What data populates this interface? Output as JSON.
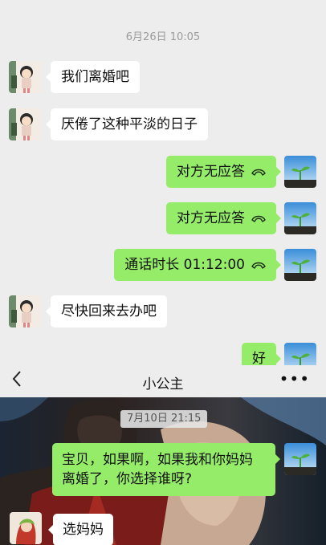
{
  "top_chat": {
    "timestamp": "6月26日 10:05",
    "messages": [
      {
        "side": "in",
        "text": "我们离婚吧"
      },
      {
        "side": "in",
        "text": "厌倦了这种平淡的日子"
      },
      {
        "side": "out",
        "text": "对方无应答",
        "call": true
      },
      {
        "side": "out",
        "text": "对方无应答",
        "call": true
      },
      {
        "side": "out",
        "text": "通话时长 01:12:00",
        "call": true
      },
      {
        "side": "in",
        "text": "尽快回来去办吧"
      },
      {
        "side": "out",
        "text": "好"
      }
    ]
  },
  "bottom_chat": {
    "header": {
      "back_icon": "chevron-left-icon",
      "title": "小公主",
      "more_icon": "more-dots-icon",
      "more_label": "•••"
    },
    "timestamp": "7月10日  21:15",
    "messages": [
      {
        "side": "out",
        "text_line1": "宝贝，如果啊，如果我和你妈妈",
        "text_line2": "离婚了，你选择谁呀?"
      },
      {
        "side": "in",
        "text": "选妈妈"
      }
    ]
  },
  "colors": {
    "background": "#ededed",
    "incoming_bubble": "#ffffff",
    "outgoing_bubble": "#95ec69",
    "timestamp_text": "#9b9b9b"
  }
}
